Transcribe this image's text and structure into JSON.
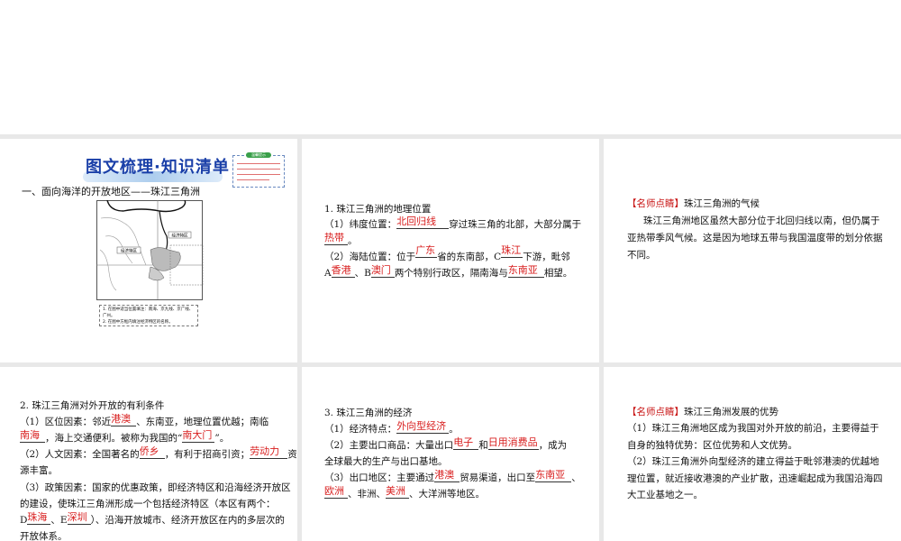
{
  "panel1": {
    "title": "图文梳理·知识清单",
    "note_label": "温馨提示",
    "section": "一、面向海洋的开放地区——珠江三角洲",
    "map": {
      "label_left": "经济特区",
      "label_right": "经济特区",
      "instructions": [
        "1. 在图中适当位置填注：南海、京九线、京广线、",
        "广州。",
        "2. 在图中方框内填注经济特区的名称。"
      ]
    }
  },
  "panel2": {
    "heading": "1. 珠江三角洲的地理位置",
    "l1a": "（1）纬度位置：",
    "a1": "北回归线",
    "l1b": "穿过珠三角的北部，大部分属于",
    "a2": "热带",
    "l2b": "。",
    "l3a": "（2）海陆位置：位于",
    "a3": "广东",
    "l3b": "省的东南部，C",
    "a4": "珠江",
    "l3c": "下游，毗邻",
    "l4a": "A",
    "a5": "香港",
    "l4b": "、B",
    "a6": "澳门",
    "l4c": "两个特别行政区，隔南海与",
    "a7": "东南亚",
    "l4d": "相望。"
  },
  "panel3": {
    "tag": "【名师点睛】",
    "heading": "珠江三角洲的气候",
    "lines": [
      "珠江三角洲地区虽然大部分位于北回归线以南，但仍属于",
      "亚热带季风气候。这是因为地球五带与我国温度带的划分依据",
      "不同。"
    ]
  },
  "panel4": {
    "heading": "2. 珠江三角洲对外开放的有利条件",
    "l1a": "（1）区位因素：邻近",
    "a1": "港澳",
    "l1b": "、东南亚，地理位置优越；南临",
    "a2": "南海",
    "l2b": "，海上交通便利。被称为我国的“",
    "a3": "南大门",
    "l2c": "”。",
    "l3a": "（2）人文因素：全国著名的",
    "a4": "侨乡",
    "l3b": "，有利于招商引资；",
    "a5": "劳动力",
    "l3c": "资",
    "l4": "源丰富。",
    "l5": "（3）政策因素：国家的优惠政策，即经济特区和沿海经济开放区",
    "l6": "的建设，使珠江三角洲形成一个包括经济特区（本区有两个：",
    "l7a": "D",
    "a6": "珠海",
    "l7b": "、E",
    "a7": "深圳",
    "l7c": "）、沿海开放城市、经济开放区在内的多层次的",
    "l8": "开放体系。"
  },
  "panel5": {
    "heading": "3. 珠江三角洲的经济",
    "l1a": "（1）经济特点：",
    "a1": "外向型经济",
    "l1b": "。",
    "l2a": "（2）主要出口商品：大量出口",
    "a2": "电子",
    "l2b": "和",
    "a3": "日用消费品",
    "l2c": "，成为",
    "l3": "全球最大的生产与出口基地。",
    "l4a": "（3）出口地区：主要通过",
    "a4": "港澳",
    "l4b": "贸易渠道，出口至",
    "a5": "东南亚",
    "l4c": "、",
    "a6": "欧洲",
    "l5b": "、非洲、",
    "a7": "美洲",
    "l5c": "、大洋洲等地区。"
  },
  "panel6": {
    "tag": "【名师点睛】",
    "heading": "珠江三角洲发展的优势",
    "lines": [
      "（1）珠江三角洲地区成为我国对外开放的前沿，主要得益于",
      "自身的独特优势：区位优势和人文优势。",
      "（2）珠江三角洲外向型经济的建立得益于毗邻港澳的优越地",
      "理位置，就近接收港澳的产业扩散，迅速崛起成为我国沿海四",
      "大工业基地之一。"
    ]
  },
  "colors": {
    "answer": "#d81e1e",
    "title": "#1a3fa8",
    "gap": "#e8e8e8"
  }
}
